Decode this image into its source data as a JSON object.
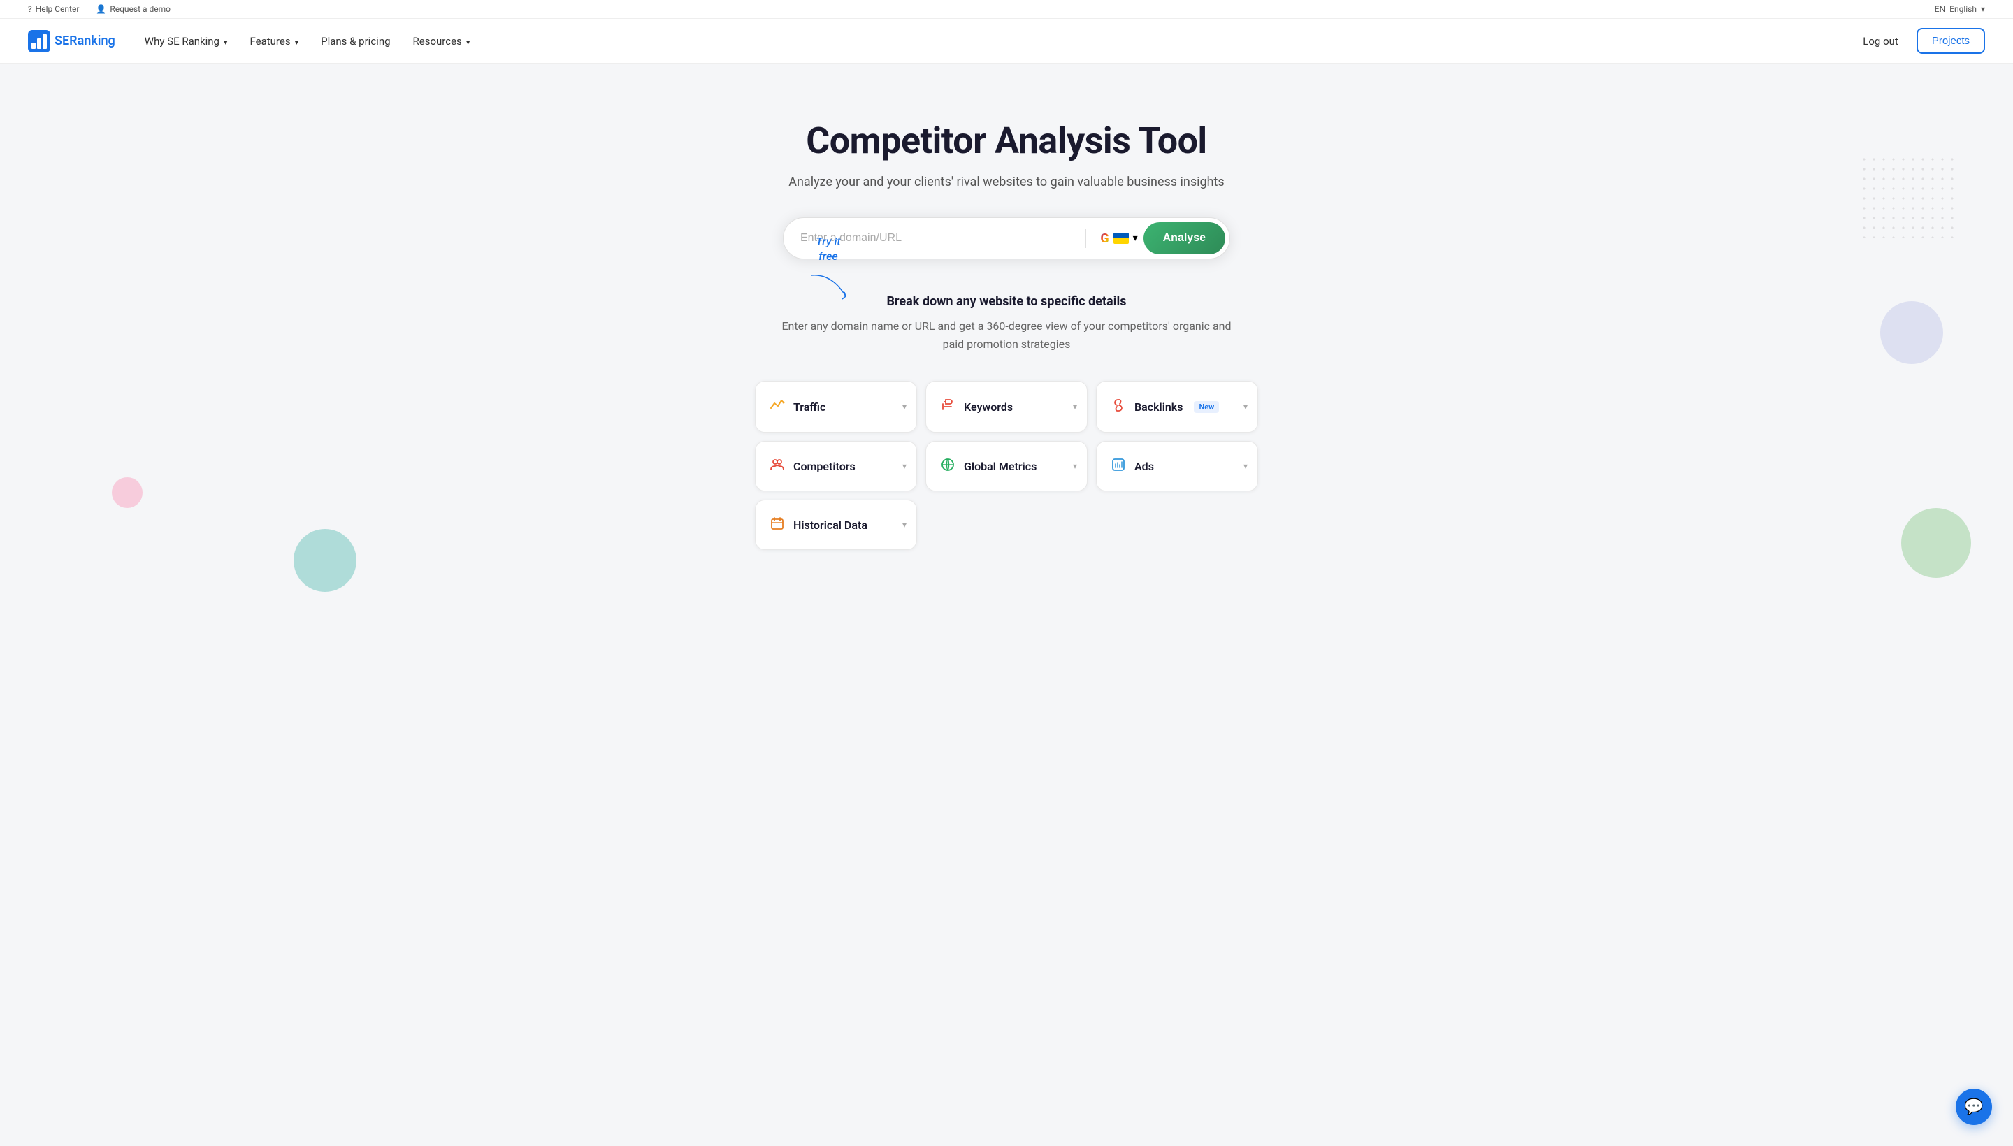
{
  "topbar": {
    "help_center": "Help Center",
    "request_demo": "Request a demo",
    "lang_code": "EN",
    "lang_name": "English"
  },
  "nav": {
    "logo_text_1": "SE",
    "logo_text_2": "Ranking",
    "items": [
      {
        "label": "Why SE Ranking",
        "has_dropdown": true
      },
      {
        "label": "Features",
        "has_dropdown": true
      },
      {
        "label": "Plans & pricing",
        "has_dropdown": false
      },
      {
        "label": "Resources",
        "has_dropdown": true
      }
    ],
    "logout_label": "Log out",
    "projects_label": "Projects"
  },
  "hero": {
    "title": "Competitor Analysis Tool",
    "subtitle": "Analyze your and your clients' rival websites to gain valuable business insights",
    "search_placeholder": "Enter a domain/URL",
    "analyse_btn": "Analyse",
    "try_free_line1": "Try it",
    "try_free_line2": "free"
  },
  "breakdown": {
    "title": "Break down any website to specific details",
    "description": "Enter any domain name or URL and get a 360-degree view of your competitors' organic and paid promotion strategies"
  },
  "cards": [
    {
      "id": "traffic",
      "label": "Traffic",
      "icon": "traffic-icon",
      "badge": null
    },
    {
      "id": "keywords",
      "label": "Keywords",
      "icon": "keywords-icon",
      "badge": null
    },
    {
      "id": "backlinks",
      "label": "Backlinks",
      "icon": "backlinks-icon",
      "badge": "New"
    },
    {
      "id": "competitors",
      "label": "Competitors",
      "icon": "competitors-icon",
      "badge": null
    },
    {
      "id": "global-metrics",
      "label": "Global Metrics",
      "icon": "global-icon",
      "badge": null
    },
    {
      "id": "ads",
      "label": "Ads",
      "icon": "ads-icon",
      "badge": null
    },
    {
      "id": "historical-data",
      "label": "Historical Data",
      "icon": "historical-icon",
      "badge": null
    }
  ],
  "colors": {
    "accent_blue": "#1a73e8",
    "accent_green": "#3cb371",
    "bg": "#f5f6f8"
  }
}
